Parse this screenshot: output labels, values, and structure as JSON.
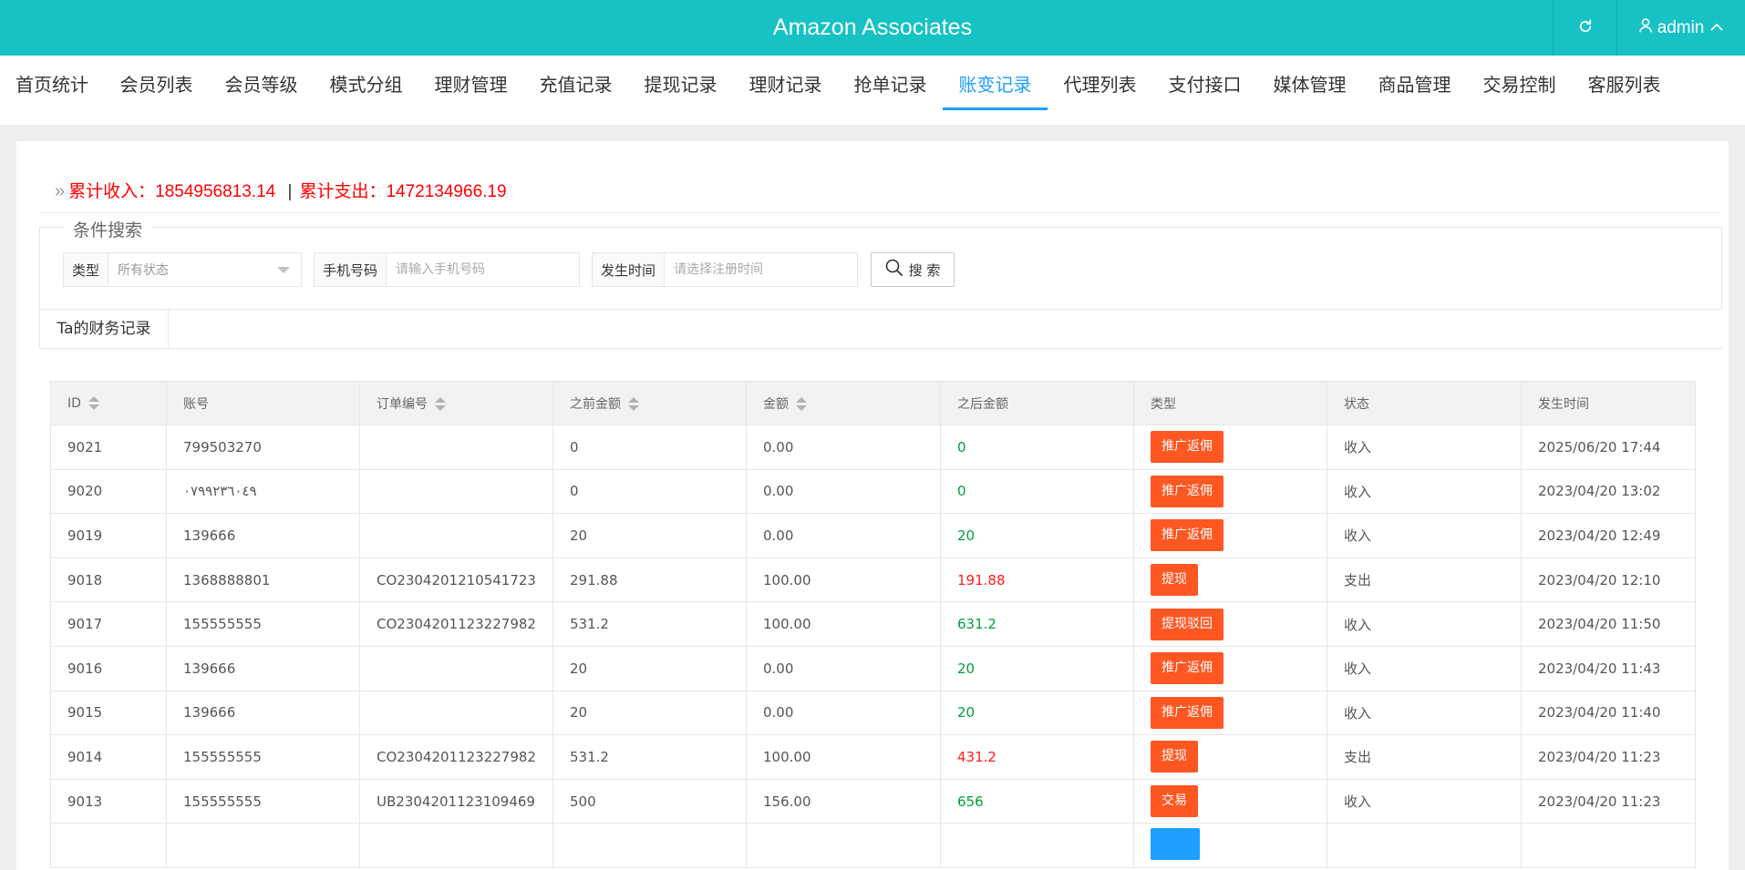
{
  "header": {
    "title": "Amazon Associates",
    "user": "admin",
    "refresh_icon": "refresh-icon",
    "user_icon": "user-icon",
    "chevron_icon": "chevron-up-icon"
  },
  "nav": {
    "items": [
      "首页统计",
      "会员列表",
      "会员等级",
      "模式分组",
      "理财管理",
      "充值记录",
      "提现记录",
      "理财记录",
      "抢单记录",
      "账变记录",
      "代理列表",
      "支付接口",
      "媒体管理",
      "商品管理",
      "交易控制",
      "客服列表"
    ],
    "active_index": 9
  },
  "summary": {
    "income_label": "累计收入：",
    "income_value": "1854956813.14",
    "separator": "|",
    "expense_label": "累计支出：",
    "expense_value": "1472134966.19"
  },
  "search": {
    "legend": "条件搜索",
    "type_label": "类型",
    "type_value": "所有状态",
    "phone_label": "手机号码",
    "phone_placeholder": "请输入手机号码",
    "time_label": "发生时间",
    "time_placeholder": "请选择注册时间",
    "button_label": "搜 索"
  },
  "tab": {
    "label": "Ta的财务记录"
  },
  "table": {
    "headers": [
      "ID",
      "账号",
      "订单编号",
      "之前金额",
      "金额",
      "之后金额",
      "类型",
      "状态",
      "发生时间"
    ],
    "rows": [
      {
        "id": "9021",
        "account": "799503270",
        "order": "",
        "before": "0",
        "amount": "0.00",
        "after": "0",
        "after_color": "green",
        "type": "推广返佣",
        "type_color": "#ff5722",
        "status": "收入",
        "time": "2025/06/20 17:44"
      },
      {
        "id": "9020",
        "account": "٠٧٩٩٢٣٦٠٤٩",
        "order": "",
        "before": "0",
        "amount": "0.00",
        "after": "0",
        "after_color": "green",
        "type": "推广返佣",
        "type_color": "#ff5722",
        "status": "收入",
        "time": "2023/04/20 13:02"
      },
      {
        "id": "9019",
        "account": "139666",
        "order": "",
        "before": "20",
        "amount": "0.00",
        "after": "20",
        "after_color": "green",
        "type": "推广返佣",
        "type_color": "#ff5722",
        "status": "收入",
        "time": "2023/04/20 12:49"
      },
      {
        "id": "9018",
        "account": "1368888801",
        "order": "CO2304201210541723",
        "before": "291.88",
        "amount": "100.00",
        "after": "191.88",
        "after_color": "red",
        "type": "提现",
        "type_color": "#ff5722",
        "status": "支出",
        "time": "2023/04/20 12:10"
      },
      {
        "id": "9017",
        "account": "155555555",
        "order": "CO2304201123227982",
        "before": "531.2",
        "amount": "100.00",
        "after": "631.2",
        "after_color": "green",
        "type": "提现驳回",
        "type_color": "#ff5722",
        "status": "收入",
        "time": "2023/04/20 11:50"
      },
      {
        "id": "9016",
        "account": "139666",
        "order": "",
        "before": "20",
        "amount": "0.00",
        "after": "20",
        "after_color": "green",
        "type": "推广返佣",
        "type_color": "#ff5722",
        "status": "收入",
        "time": "2023/04/20 11:43"
      },
      {
        "id": "9015",
        "account": "139666",
        "order": "",
        "before": "20",
        "amount": "0.00",
        "after": "20",
        "after_color": "green",
        "type": "推广返佣",
        "type_color": "#ff5722",
        "status": "收入",
        "time": "2023/04/20 11:40"
      },
      {
        "id": "9014",
        "account": "155555555",
        "order": "CO2304201123227982",
        "before": "531.2",
        "amount": "100.00",
        "after": "431.2",
        "after_color": "red",
        "type": "提现",
        "type_color": "#ff5722",
        "status": "支出",
        "time": "2023/04/20 11:23"
      },
      {
        "id": "9013",
        "account": "155555555",
        "order": "UB2304201123109469",
        "before": "500",
        "amount": "156.00",
        "after": "656",
        "after_color": "green",
        "type": "交易",
        "type_color": "#ff5722",
        "status": "收入",
        "time": "2023/04/20 11:23"
      },
      {
        "id": "",
        "account": "",
        "order": "",
        "before": "",
        "amount": "",
        "after": "",
        "after_color": "green",
        "type": "",
        "type_color": "#1e9fff",
        "status": "",
        "time": ""
      }
    ]
  },
  "colors": {
    "header_bg": "#16c2c4",
    "accent": "#1e9fff",
    "badge_orange": "#ff5722",
    "positive": "#009f3c",
    "negative": "#ff1a1a"
  }
}
